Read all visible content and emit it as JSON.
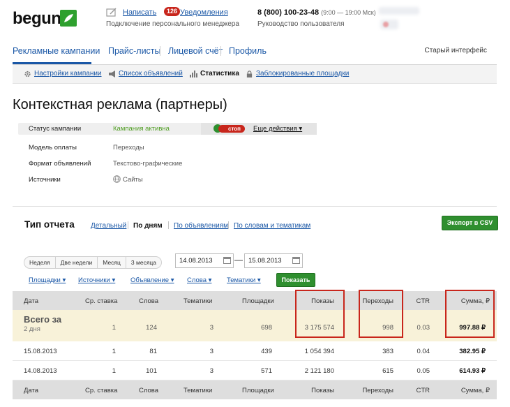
{
  "header": {
    "logo": "begun",
    "write_link": "Написать",
    "notifications_count": "126",
    "notifications_link": "Уведомления",
    "manager_connect": "Подключение персонального менеджера",
    "phone": "8 (800) 100-23-48",
    "phone_hours": "(9:00 — 19:00 Мск)",
    "user_guide": "Руководство пользователя"
  },
  "nav": {
    "items": [
      {
        "label": "Рекламные кампании",
        "active": true
      },
      {
        "label": "Прайс-листы"
      },
      {
        "label": "Лицевой счёт"
      },
      {
        "label": "Профиль"
      }
    ],
    "old_interface": "Старый интерфейс"
  },
  "subnav": {
    "items": [
      {
        "label": "Настройки кампании",
        "icon": "gear-icon"
      },
      {
        "label": "Список объявлений",
        "icon": "megaphone-icon"
      },
      {
        "label": "Статистика",
        "icon": "bar-chart-icon",
        "active": true
      },
      {
        "label": "Заблокированные площадки",
        "icon": "lock-icon"
      }
    ]
  },
  "page_title": "Контекстная реклама (партнеры)",
  "campaign": {
    "status_label": "Статус кампании",
    "status_value": "Кампания активна",
    "stop_label": "стоп",
    "more_actions": "Еще действия ▾",
    "payment_label": "Модель оплаты",
    "payment_value": "Переходы",
    "format_label": "Формат объявлений",
    "format_value": "Текстово-графические",
    "sources_label": "Источники",
    "sources_value": "Сайты"
  },
  "report": {
    "title": "Тип отчета",
    "tabs": [
      {
        "label": "Детальный"
      },
      {
        "label": "По дням",
        "active": true
      },
      {
        "label": "По объявлениям"
      },
      {
        "label": "По словам и тематикам"
      }
    ],
    "export_button": "Экспорт в CSV",
    "periods": [
      "Неделя",
      "Две недели",
      "Месяц",
      "3 месяца"
    ],
    "date_from": "14.08.2013",
    "date_to": "15.08.2013",
    "date_separator": "—",
    "filters": [
      "Площадки ▾",
      "Источники ▾",
      "Объявление ▾",
      "Слова ▾",
      "Тематики ▾"
    ],
    "show_button": "Показать"
  },
  "table": {
    "columns": [
      "Дата",
      "Ср. ставка",
      "Слова",
      "Тематики",
      "Площадки",
      "Показы",
      "Переходы",
      "CTR",
      "Сумма, ₽"
    ],
    "total": {
      "title": "Всего за",
      "subtitle": "2 дня",
      "values": [
        "1",
        "124",
        "3",
        "698",
        "3 175 574",
        "998",
        "0.03",
        "997.88 ₽"
      ]
    },
    "rows": [
      {
        "date": "15.08.2013",
        "values": [
          "1",
          "81",
          "3",
          "439",
          "1 054 394",
          "383",
          "0.04",
          "382.95 ₽"
        ]
      },
      {
        "date": "14.08.2013",
        "values": [
          "1",
          "101",
          "3",
          "571",
          "2 121 180",
          "615",
          "0.05",
          "614.93 ₽"
        ]
      }
    ]
  },
  "colors": {
    "link": "#1a57a6",
    "green_button": "#2f8f2f",
    "highlight_box": "#c8261c",
    "total_row_bg": "#f8f2d9"
  }
}
